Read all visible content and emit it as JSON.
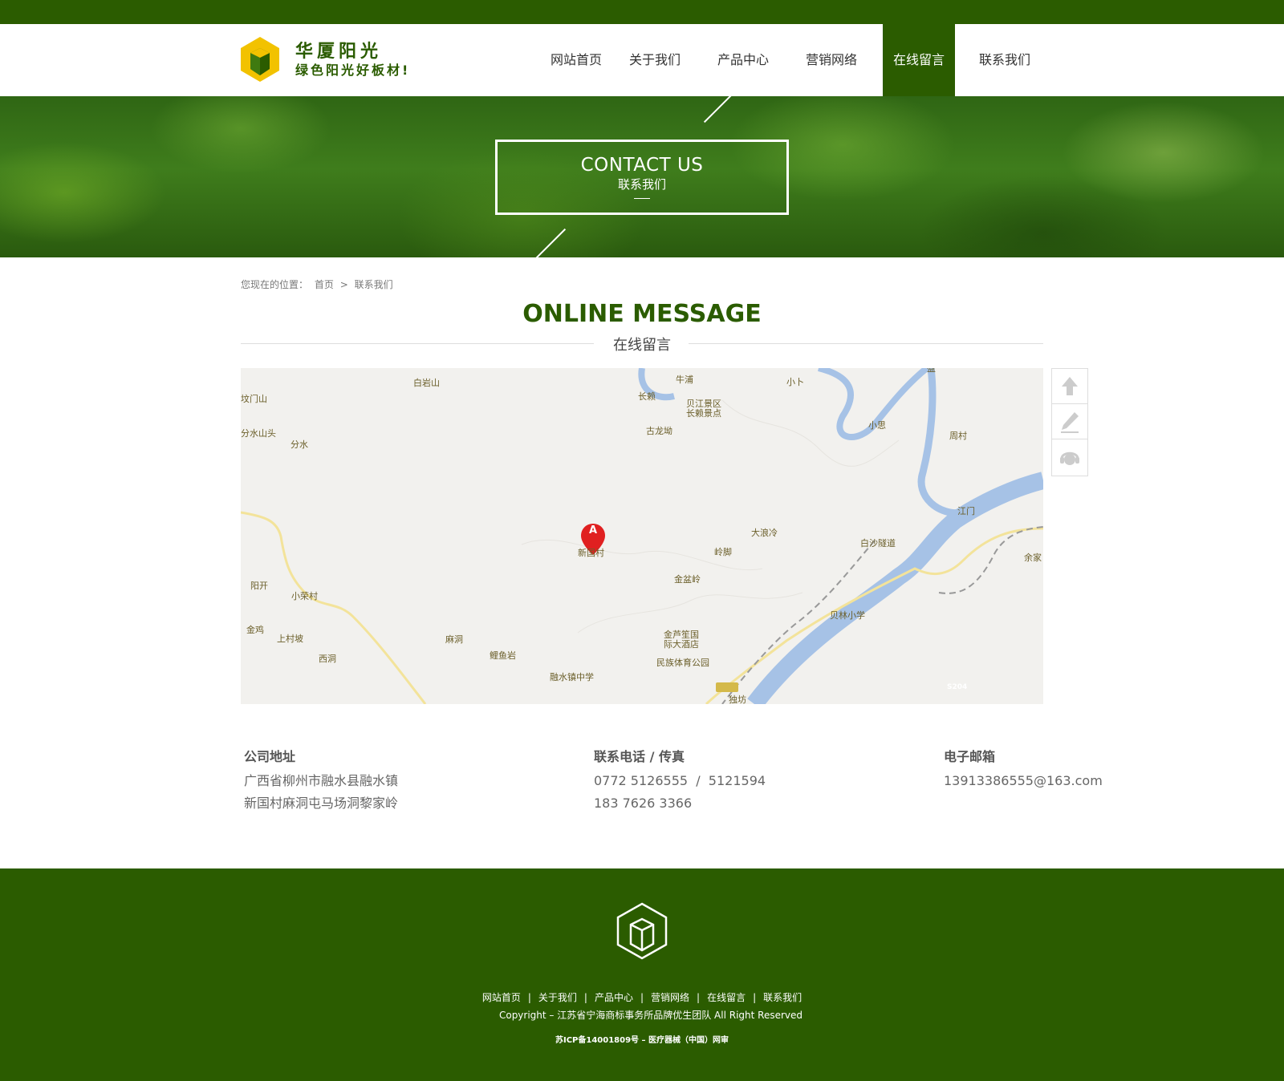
{
  "header": {
    "logo_title": "华厦阳光",
    "logo_slogan": "绿色阳光好板材!",
    "nav": [
      {
        "label": "网站首页"
      },
      {
        "label": "关于我们"
      },
      {
        "label": "产品中心"
      },
      {
        "label": "营销网络"
      },
      {
        "label": "在线留言"
      },
      {
        "label": "联系我们"
      }
    ],
    "active_nav": "在线留言"
  },
  "banner": {
    "title_en": "CONTACT US",
    "title_cn": "联系我们"
  },
  "breadcrumb": {
    "prefix": "您现在的位置：",
    "home": "首页",
    "separator": ">",
    "current": "联系我们"
  },
  "section": {
    "title_en": "ONLINE MESSAGE",
    "title_cn": "在线留言"
  },
  "map": {
    "marker_letter": "A",
    "marker_label": "新国村",
    "road_badge": "S204",
    "labels": [
      "白岩山",
      "坟门山",
      "分水山头",
      "分水",
      "牛浦",
      "长赖",
      "贝江景区",
      "长赖景点",
      "古龙坳",
      "小卜",
      "盈",
      "小思",
      "周村",
      "江门",
      "大浪冷",
      "白沙隧道",
      "岭脚",
      "金盆岭",
      "余家",
      "阳开",
      "小荣村",
      "金鸡",
      "上村坡",
      "西洞",
      "麻洞",
      "鲤鱼岩",
      "融水镇中学",
      "金芦笙国",
      "际大酒店",
      "民族体育公园",
      "贝林小学",
      "独坊"
    ],
    "colors": {
      "water": "#a6c2e6",
      "road": "#f3e39a",
      "land": "#f2f1ee"
    }
  },
  "side_tools": [
    {
      "icon": "arrow-up-icon"
    },
    {
      "icon": "pencil-icon"
    },
    {
      "icon": "headset-icon"
    }
  ],
  "contact": {
    "address_label": "公司地址",
    "address_lines": [
      "广西省柳州市融水县融水镇",
      "新国村麻洞屯马场洞黎家岭"
    ],
    "phone_label": "联系电话 / 传真",
    "phone_lines": [
      "0772 5126555  /  5121594",
      "183 7626 3366"
    ],
    "email_label": "电子邮箱",
    "email": "13913386555@163.com"
  },
  "footer": {
    "links": [
      "网站首页",
      "关于我们",
      "产品中心",
      "营销网络",
      "在线留言",
      "联系我们"
    ],
    "separator": "|",
    "copyright": "Copyright – 江苏省宁海商标事务所品牌优生团队 All Right Reserved",
    "icp": "苏ICP备14001809号 – 医疗器械（中国）网审"
  },
  "colors": {
    "brand_green": "#2b5c00",
    "logo_yellow": "#f2c200",
    "white": "#ffffff"
  }
}
